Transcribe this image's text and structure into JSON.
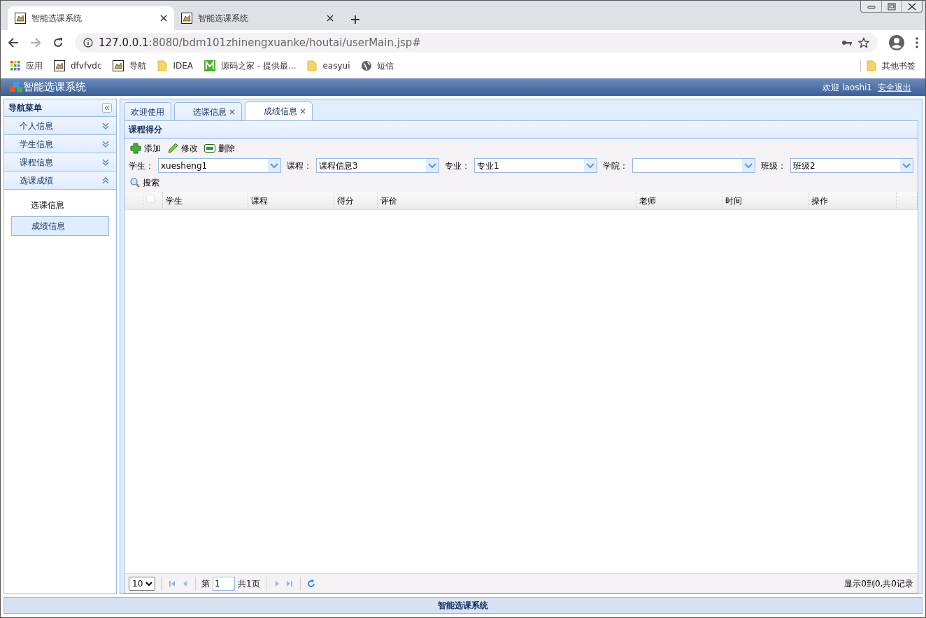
{
  "browser": {
    "tabs": [
      {
        "title": "智能选课系统",
        "selected": true
      },
      {
        "title": "智能选课系统",
        "selected": false
      }
    ],
    "address": {
      "host": "127.0.0.1",
      "path": ":8080/bdm101zhinengxuanke/houtai/userMain.jsp#"
    },
    "bookmarks": [
      {
        "label": "应用",
        "kind": "apps"
      },
      {
        "label": "dfvfvdc",
        "kind": "page"
      },
      {
        "label": "导航",
        "kind": "page"
      },
      {
        "label": "IDEA",
        "kind": "folder"
      },
      {
        "label": "源码之家 - 提供最...",
        "kind": "m"
      },
      {
        "label": "easyui",
        "kind": "folder"
      },
      {
        "label": "短信",
        "kind": "globe"
      }
    ],
    "other_bookmarks": "其他书签"
  },
  "app": {
    "title": "智能选课系统",
    "welcome": "欢迎 laoshi1",
    "logout": "安全退出",
    "nav": {
      "title": "导航菜单",
      "sections": [
        {
          "label": "个人信息",
          "expanded": false
        },
        {
          "label": "学生信息",
          "expanded": false
        },
        {
          "label": "课程信息",
          "expanded": false
        },
        {
          "label": "选课成绩",
          "expanded": true,
          "items": [
            {
              "label": "选课信息",
              "selected": false
            },
            {
              "label": "成绩信息",
              "selected": true
            }
          ]
        }
      ]
    },
    "tabs": [
      {
        "label": "欢迎使用",
        "closable": false,
        "selected": false
      },
      {
        "label": "选课信息",
        "closable": true,
        "selected": false
      },
      {
        "label": "成绩信息",
        "closable": true,
        "selected": true
      }
    ],
    "panel_title": "课程得分",
    "toolbar": [
      {
        "label": "添加",
        "kind": "add"
      },
      {
        "label": "修改",
        "kind": "edit"
      },
      {
        "label": "删除",
        "kind": "delete"
      }
    ],
    "filters": [
      {
        "label": "学生：",
        "value": "xuesheng1"
      },
      {
        "label": "课程：",
        "value": "课程信息3"
      },
      {
        "label": "专业：",
        "value": "专业1"
      },
      {
        "label": "学院："
      },
      {
        "label": "班级：",
        "value": "班级2"
      }
    ],
    "search": "搜索",
    "select_all_checked": false,
    "columns": [
      "学生",
      "课程",
      "得分",
      "评价",
      "老师",
      "时间",
      "操作"
    ],
    "pager": {
      "page_size": "10",
      "page_label": "第",
      "page": "1",
      "total": "共1页",
      "summary": "显示0到0,共0记录"
    },
    "footer": "智能选课系统"
  }
}
